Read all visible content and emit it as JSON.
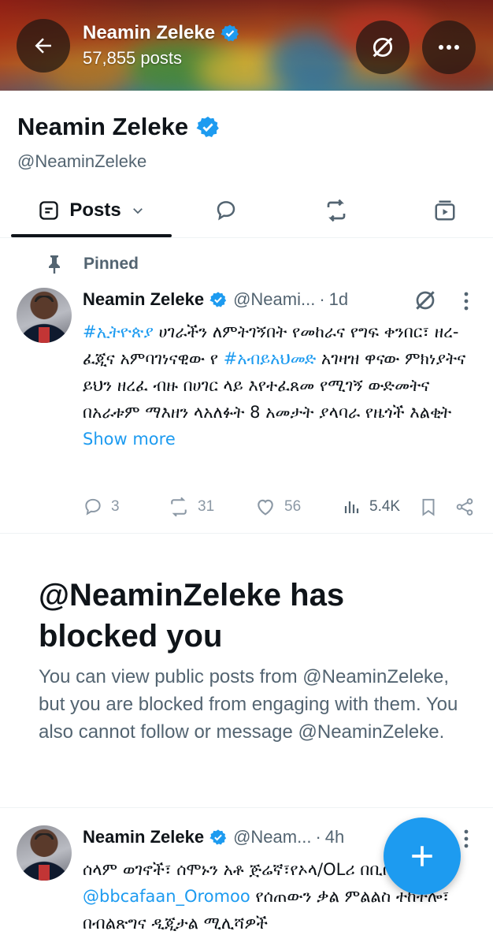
{
  "header": {
    "name": "Neamin Zeleke",
    "post_count": "57,855 posts"
  },
  "profile": {
    "name": "Neamin Zeleke",
    "handle": "@NeaminZeleke"
  },
  "tabs": {
    "posts_label": "Posts"
  },
  "pinned_post": {
    "pinned_label": "Pinned",
    "author_name": "Neamin Zeleke",
    "author_handle": "@Neami...",
    "dot": "·",
    "time": "1d",
    "text_segments": {
      "hashtag1": "#ኢትዮጵያ",
      "part1": " ሀገራችን ለምትገኝበት የመከራና የግፍ ቀንበር፣ ዘረ-ፈጂና አምባገነናዊው የ ",
      "hashtag2": "#አብይአህመድ",
      "part2": " አገዛዝ ዋናው ምክነያትና ይህን ዘረፈ ብዙ በሀገር ላይ እየተፈጸመ የሚገኝ  ውድመትና በአራቱም ማእዘን ላአለፉት 8 አመታት ያላባራ የዜጎች እልቂት ",
      "show_more": "Show more"
    },
    "stats": {
      "replies": "3",
      "reposts": "31",
      "likes": "56",
      "views": "5.4K"
    }
  },
  "blocked_notice": {
    "title": "@NeaminZeleke has blocked you",
    "body": "You can view public posts from @NeaminZeleke, but you are blocked from engaging with them. You also cannot follow or message @NeaminZeleke."
  },
  "second_post": {
    "author_name": "Neamin Zeleke",
    "author_handle": "@Neam...",
    "dot": "·",
    "time": "4h",
    "text_segments": {
      "part1": "ሰላም ወገኖች፣ ሰሞኑን አቶ ጅሬኛ፣የኦላ/OL",
      "part1b": "ሪ በቢቢሲ/BBC ",
      "mention": "@bbcafaan_Oromoo",
      "part2": " የሰጠውን ቃል ምልልስ ተከትሎ፣ በብልጽግና ዲጂታል ሚሊሻዎች"
    }
  },
  "colors": {
    "accent": "#1d9bf0",
    "text_primary": "#0f1419",
    "text_secondary": "#536471"
  },
  "icons": {
    "back": "arrow-left-icon",
    "grok": "grok-icon",
    "more": "more-horizontal-icon",
    "verified": "verified-badge-icon",
    "pin": "pin-icon",
    "compose": "plus-icon"
  }
}
